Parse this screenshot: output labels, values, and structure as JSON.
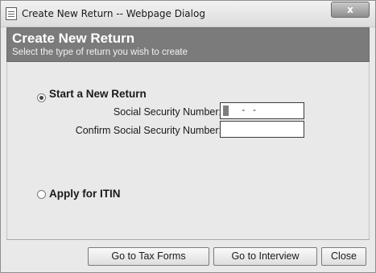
{
  "window": {
    "title": "Create New Return -- Webpage Dialog",
    "close_label": "x"
  },
  "header": {
    "title": "Create New Return",
    "subtitle": "Select the type of return you wish to create"
  },
  "options": {
    "new_return": {
      "label": "Start a New Return",
      "selected": true
    },
    "itin": {
      "label": "Apply for ITIN",
      "selected": false
    }
  },
  "fields": {
    "ssn": {
      "label": "Social Security Number:",
      "value": " -  -"
    },
    "confirm_ssn": {
      "label": "Confirm Social Security Number:",
      "value": ""
    }
  },
  "buttons": {
    "tax_forms": "Go to Tax Forms",
    "interview": "Go to Interview",
    "close": "Close"
  }
}
